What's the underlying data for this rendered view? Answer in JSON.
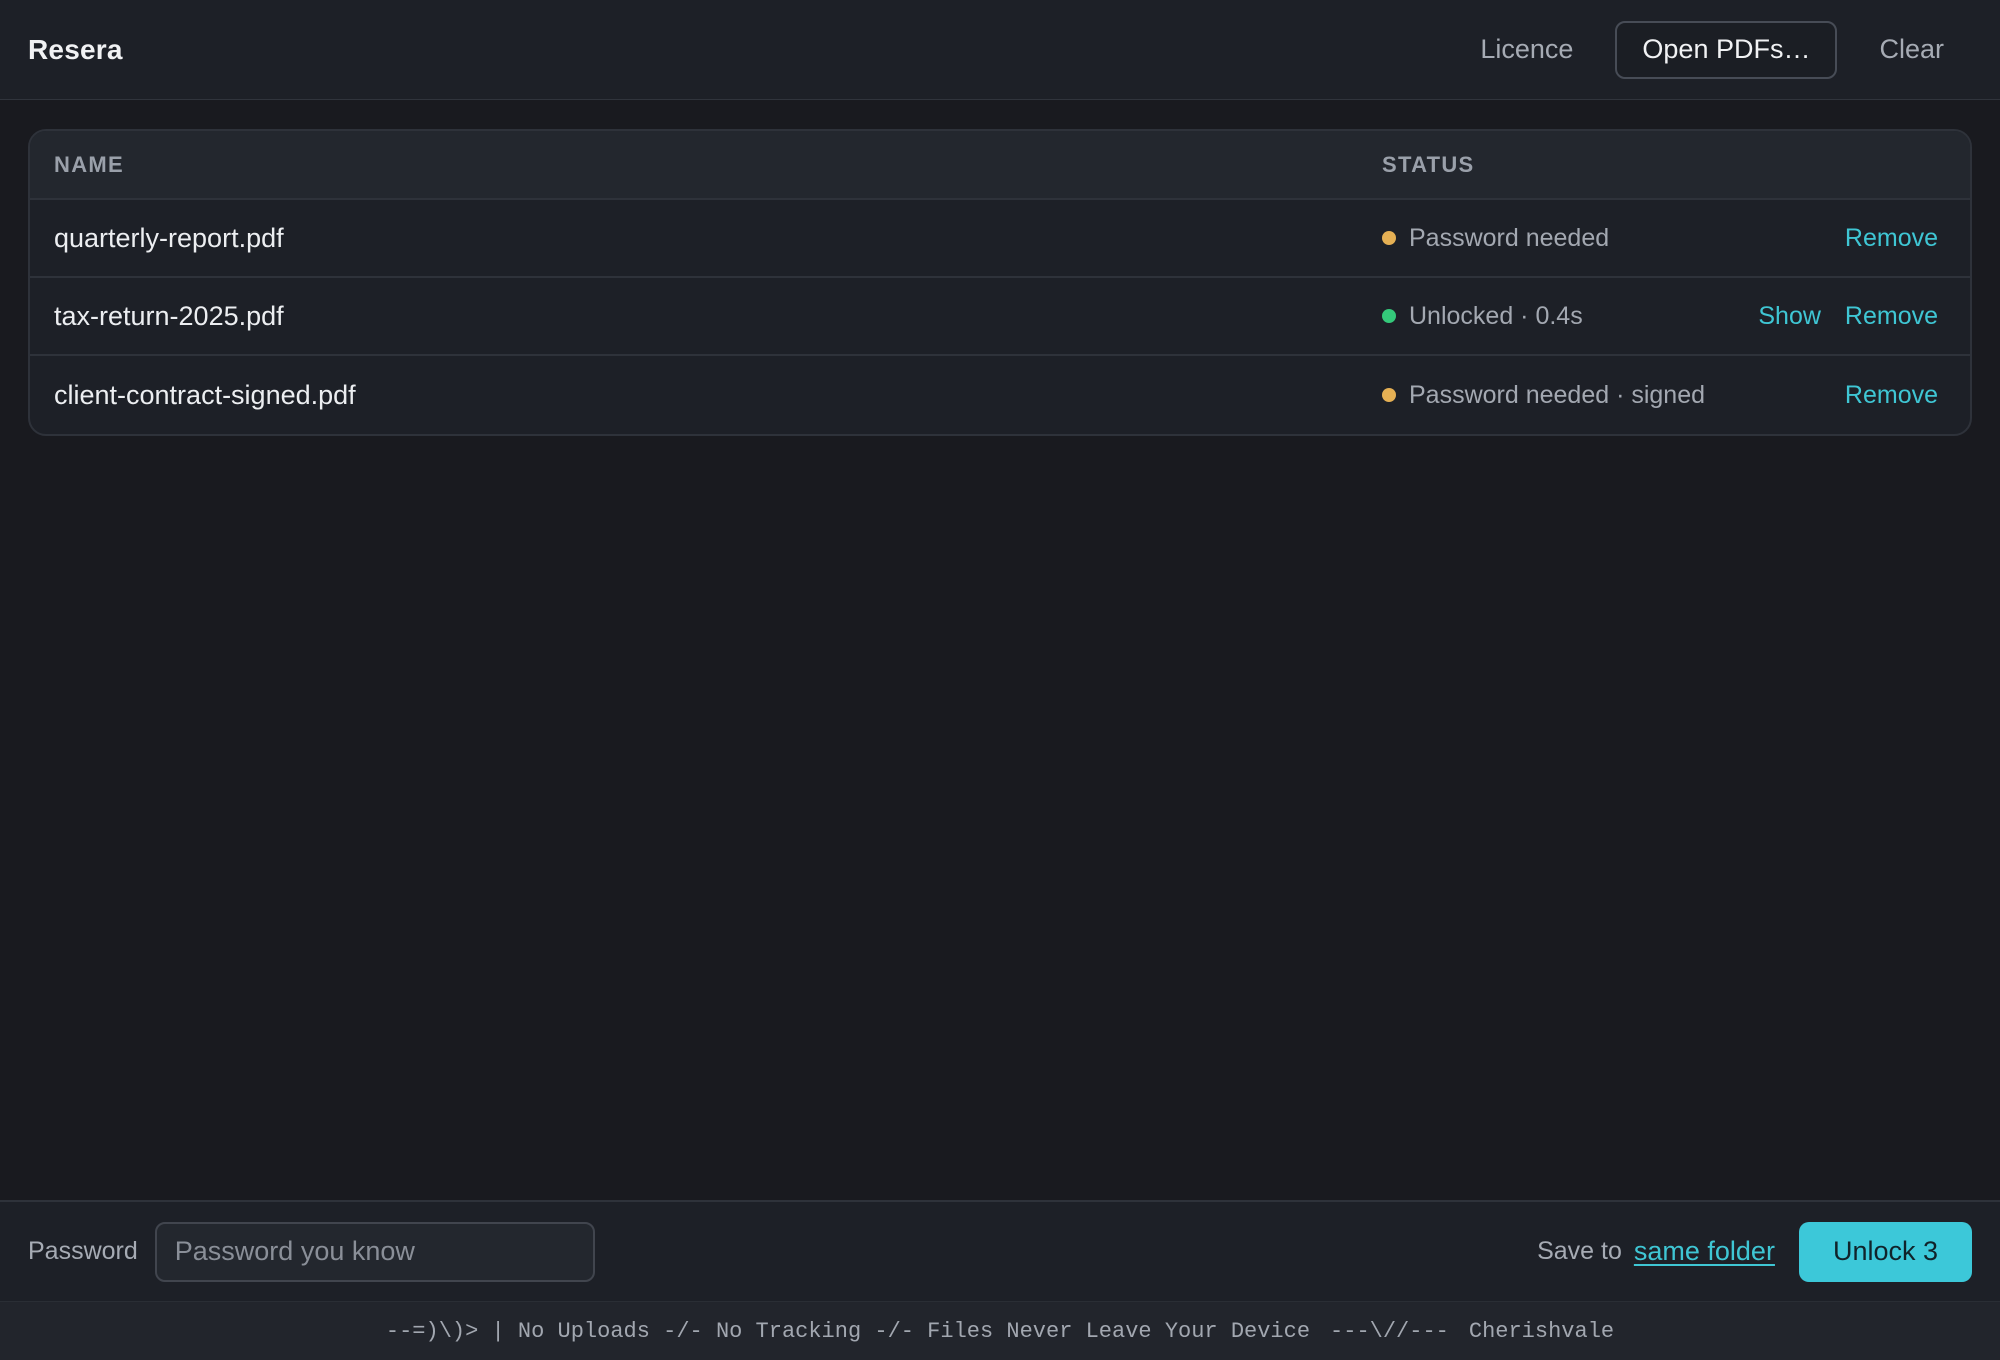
{
  "header": {
    "brand": "Resera",
    "licence_label": "Licence",
    "open_label": "Open PDFs…",
    "clear_label": "Clear"
  },
  "table": {
    "columns": [
      "NAME",
      "STATUS"
    ],
    "rows": [
      {
        "name": "quarterly-report.pdf",
        "status": "Password needed",
        "status_type": "warn",
        "show_label": "",
        "remove_label": "Remove"
      },
      {
        "name": "tax-return-2025.pdf",
        "status": "Unlocked · 0.4s",
        "status_type": "ok",
        "show_label": "Show",
        "remove_label": "Remove"
      },
      {
        "name": "client-contract-signed.pdf",
        "status": "Password needed · signed",
        "status_type": "warn",
        "show_label": "",
        "remove_label": "Remove"
      }
    ]
  },
  "bottom": {
    "password_label": "Password",
    "password_placeholder": "Password you know",
    "password_value": "",
    "save_label": "Save to",
    "save_location": "same folder",
    "unlock_label": "Unlock 3"
  },
  "footer": {
    "tagline": "--=)\\)> | No Uploads -/- No Tracking -/- Files Never Leave Your Device",
    "divider": "---\\//---",
    "maker": "Cherishvale"
  },
  "colors": {
    "accent": "#3cc8d9",
    "warn": "#e5b054",
    "ok": "#34c97a",
    "background": "#191a1f"
  }
}
